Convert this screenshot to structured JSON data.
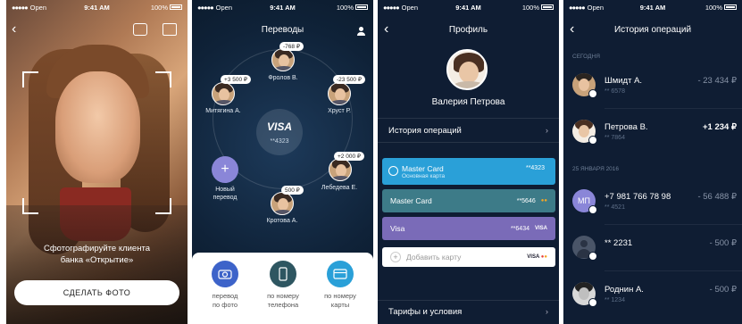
{
  "status_bar": {
    "carrier": "Open",
    "time": "9:41 AM",
    "battery": "100%"
  },
  "screen1": {
    "caption_line1": "Сфотографируйте клиента",
    "caption_line2": "банка «Открытие»",
    "button": "СДЕЛАТЬ ФОТО"
  },
  "screen2": {
    "title": "Переводы",
    "card_brand": "VISA",
    "card_number": "**4323",
    "contacts": [
      {
        "name": "Фролов В.",
        "amount": "-768 ₽"
      },
      {
        "name": "Хруст Р.",
        "amount": "-23 500 ₽"
      },
      {
        "name": "Митягина А.",
        "amount": "+3 500 ₽"
      },
      {
        "name": "Лебедева Е.",
        "amount": "+2 000 ₽"
      },
      {
        "name": "Кротова А.",
        "amount": "500 ₽"
      }
    ],
    "new_transfer_line1": "Новый",
    "new_transfer_line2": "перевод",
    "actions": [
      {
        "line1": "перевод",
        "line2": "по фото",
        "color": "#3d63c9",
        "icon": "camera-icon"
      },
      {
        "line1": "по номеру",
        "line2": "телефона",
        "color": "#2e5661",
        "icon": "phone-icon"
      },
      {
        "line1": "по номеру",
        "line2": "карты",
        "color": "#2aa0d8",
        "icon": "card-icon"
      }
    ]
  },
  "screen3": {
    "title": "Профиль",
    "name": "Валерия Петрова",
    "history": "История операций",
    "cards": [
      {
        "name": "Master Card",
        "sub": "Основная карта",
        "number": "**4323",
        "color": "#2aa0d8"
      },
      {
        "name": "Master Card",
        "number": "**5646",
        "color": "#3d7b88"
      },
      {
        "name": "Visa",
        "number": "**6434",
        "brand": "VISA",
        "color": "#7a6bb8"
      }
    ],
    "add_card": "Добавить карту",
    "add_card_logos": "VISA",
    "tariffs": "Тарифы и условия"
  },
  "screen4": {
    "title": "История операций",
    "section_today": "СЕГОДНЯ",
    "section_date": "25 ЯНВАРЯ 2016",
    "operations": [
      {
        "name": "Шмидт А.",
        "sub": "** 6578",
        "amount": "- 23 434 ₽",
        "positive": false
      },
      {
        "name": "Петрова В.",
        "sub": "** 7864",
        "amount": "+1 234 ₽",
        "positive": true
      },
      {
        "name": "+7 981 766 78 98",
        "sub": "** 4521",
        "amount": "- 56 488 ₽",
        "positive": false,
        "initials": "МП"
      },
      {
        "name": "** 2231",
        "sub": "",
        "amount": "- 500 ₽",
        "positive": false
      },
      {
        "name": "Роднин А.",
        "sub": "** 1234",
        "amount": "- 500 ₽",
        "positive": false
      }
    ]
  }
}
